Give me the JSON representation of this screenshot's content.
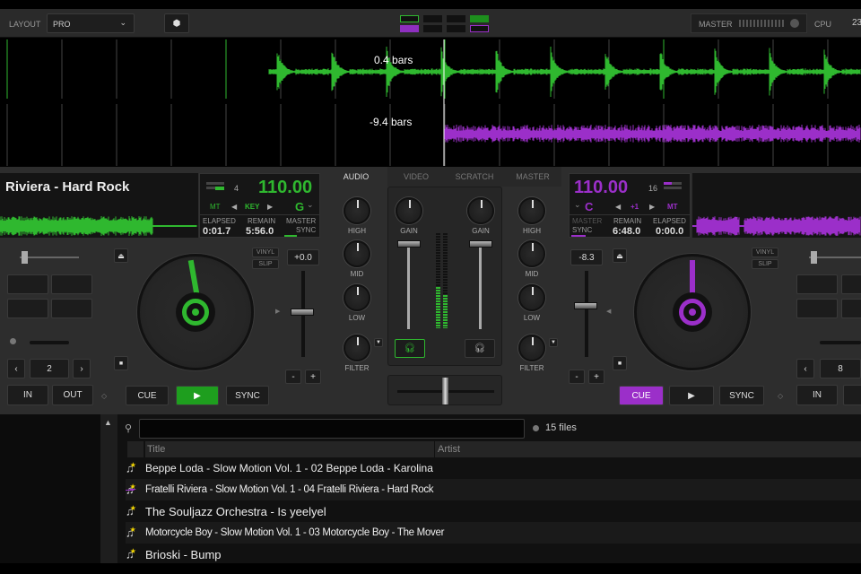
{
  "topbar": {
    "layout_label": "LAYOUT",
    "layout_value": "PRO",
    "master_label": "MASTER",
    "cpu_label": "CPU",
    "cpu_value": "23"
  },
  "waveform": {
    "deck1_offset": "0.4 bars",
    "deck2_offset": "-9.4 bars"
  },
  "deck1": {
    "title": "Riviera - Hard Rock",
    "beats": "4",
    "bpm": "110.00",
    "mt": "MT",
    "key_label": "KEY",
    "key": "G",
    "elapsed_label": "ELAPSED",
    "elapsed": "0:01.7",
    "remain_label": "REMAIN",
    "remain": "5:56.0",
    "master_label": "MASTER",
    "sync_label": "SYNC",
    "vinyl": "VINYL",
    "slip": "SLIP",
    "pitch": "+0.0",
    "loop": "2",
    "in": "IN",
    "out": "OUT",
    "cue": "CUE",
    "play": "▶",
    "sync": "SYNC",
    "color": "#2fb82f"
  },
  "deck2": {
    "beats": "16",
    "bpm": "110.00",
    "mt": "MT",
    "key_shift": "+1",
    "key": "C",
    "elapsed_label": "ELAPSED",
    "elapsed": "0:00.0",
    "remain_label": "REMAIN",
    "remain": "6:48.0",
    "master_label": "MASTER",
    "sync_label": "SYNC",
    "vinyl": "VINYL",
    "slip": "SLIP",
    "pitch": "-8.3",
    "loop": "8",
    "in": "IN",
    "cue": "CUE",
    "play": "▶",
    "sync": "SYNC",
    "color": "#9b2fc9"
  },
  "mixer": {
    "tabs": [
      "AUDIO",
      "VIDEO",
      "SCRATCH",
      "MASTER"
    ],
    "high": "HIGH",
    "mid": "MID",
    "low": "LOW",
    "filter": "FILTER",
    "gain": "GAIN"
  },
  "browser": {
    "count": "15 files",
    "columns": [
      "Title",
      "Artist"
    ],
    "rows": [
      "Beppe Loda - Slow Motion Vol. 1 - 02 Beppe Loda - Karolina",
      "Fratelli Riviera - Slow Motion Vol. 1 - 04 Fratelli Riviera - Hard Rock",
      "The Souljazz Orchestra - Is yeelyel",
      "Motorcycle Boy - Slow Motion Vol. 1 - 03 Motorcycle Boy - The Mover",
      "Brioski - Bump"
    ]
  }
}
